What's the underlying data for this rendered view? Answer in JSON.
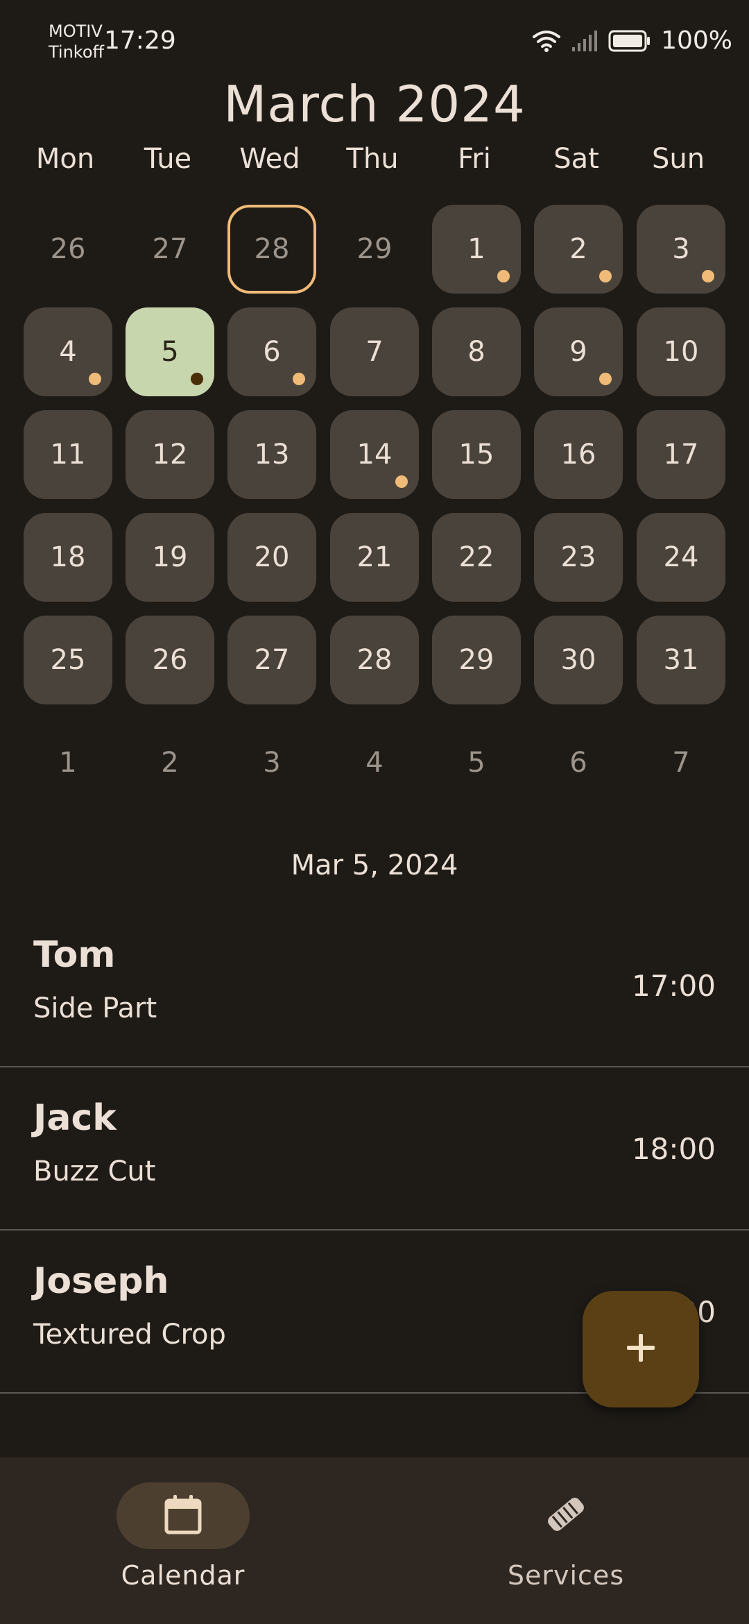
{
  "status_bar": {
    "carrier_line1": "MOTIV",
    "carrier_line2": "Tinkoff",
    "time": "17:29",
    "battery": "100%",
    "icons": [
      "wifi-icon",
      "signal-icon",
      "battery-icon"
    ]
  },
  "calendar": {
    "month_title": "March 2024",
    "weekdays": [
      "Mon",
      "Tue",
      "Wed",
      "Thu",
      "Fri",
      "Sat",
      "Sun"
    ],
    "weeks": [
      [
        {
          "d": "26",
          "state": "outside",
          "dot": false
        },
        {
          "d": "27",
          "state": "outside",
          "dot": false
        },
        {
          "d": "28",
          "state": "today",
          "dot": false
        },
        {
          "d": "29",
          "state": "outside",
          "dot": false
        },
        {
          "d": "1",
          "state": "filled",
          "dot": true
        },
        {
          "d": "2",
          "state": "filled",
          "dot": true
        },
        {
          "d": "3",
          "state": "filled",
          "dot": true
        }
      ],
      [
        {
          "d": "4",
          "state": "filled",
          "dot": true
        },
        {
          "d": "5",
          "state": "selected",
          "dot": true
        },
        {
          "d": "6",
          "state": "filled",
          "dot": true
        },
        {
          "d": "7",
          "state": "filled",
          "dot": false
        },
        {
          "d": "8",
          "state": "filled",
          "dot": false
        },
        {
          "d": "9",
          "state": "filled",
          "dot": true
        },
        {
          "d": "10",
          "state": "filled",
          "dot": false
        }
      ],
      [
        {
          "d": "11",
          "state": "filled",
          "dot": false
        },
        {
          "d": "12",
          "state": "filled",
          "dot": false
        },
        {
          "d": "13",
          "state": "filled",
          "dot": false
        },
        {
          "d": "14",
          "state": "filled",
          "dot": true
        },
        {
          "d": "15",
          "state": "filled",
          "dot": false
        },
        {
          "d": "16",
          "state": "filled",
          "dot": false
        },
        {
          "d": "17",
          "state": "filled",
          "dot": false
        }
      ],
      [
        {
          "d": "18",
          "state": "filled",
          "dot": false
        },
        {
          "d": "19",
          "state": "filled",
          "dot": false
        },
        {
          "d": "20",
          "state": "filled",
          "dot": false
        },
        {
          "d": "21",
          "state": "filled",
          "dot": false
        },
        {
          "d": "22",
          "state": "filled",
          "dot": false
        },
        {
          "d": "23",
          "state": "filled",
          "dot": false
        },
        {
          "d": "24",
          "state": "filled",
          "dot": false
        }
      ],
      [
        {
          "d": "25",
          "state": "filled",
          "dot": false
        },
        {
          "d": "26",
          "state": "filled",
          "dot": false
        },
        {
          "d": "27",
          "state": "filled",
          "dot": false
        },
        {
          "d": "28",
          "state": "filled",
          "dot": false
        },
        {
          "d": "29",
          "state": "filled",
          "dot": false
        },
        {
          "d": "30",
          "state": "filled",
          "dot": false
        },
        {
          "d": "31",
          "state": "filled",
          "dot": false
        }
      ],
      [
        {
          "d": "1",
          "state": "outside",
          "dot": false
        },
        {
          "d": "2",
          "state": "outside",
          "dot": false
        },
        {
          "d": "3",
          "state": "outside",
          "dot": false
        },
        {
          "d": "4",
          "state": "outside",
          "dot": false
        },
        {
          "d": "5",
          "state": "outside",
          "dot": false
        },
        {
          "d": "6",
          "state": "outside",
          "dot": false
        },
        {
          "d": "7",
          "state": "outside",
          "dot": false
        }
      ]
    ]
  },
  "selected_date": "Mar 5, 2024",
  "appointments": [
    {
      "name": "Tom",
      "service": "Side Part",
      "time": "17:00"
    },
    {
      "name": "Jack",
      "service": "Buzz Cut",
      "time": "18:00"
    },
    {
      "name": "Joseph",
      "service": "Textured Crop",
      "time": "19:00"
    }
  ],
  "fab": {
    "icon": "plus-icon"
  },
  "nav": {
    "calendar_label": "Calendar",
    "services_label": "Services",
    "calendar_icon": "calendar-icon",
    "services_icon": "handshake-icon"
  },
  "colors": {
    "background": "#1e1b17",
    "cell": "#4a433b",
    "selected": "#c8d6ad",
    "accent_dot": "#f0bb78",
    "fab": "#5b4016",
    "nav_bg": "#2e2620"
  }
}
